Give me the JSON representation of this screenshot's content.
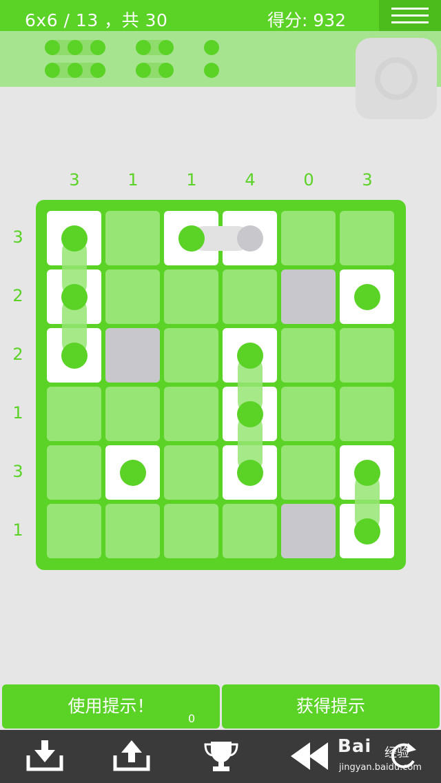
{
  "header": {
    "level_text": "6x6 / 13 ，共 30",
    "score_text": "得分: 932",
    "menu_icon": "hamburger-menu-icon",
    "accent_color": "#5ad226"
  },
  "pieces_tray": {
    "groups": [
      {
        "name": "size-3",
        "rows": 2,
        "dots_per_row": 3
      },
      {
        "name": "size-2",
        "rows": 2,
        "dots_per_row": 2
      },
      {
        "name": "size-1",
        "rows": 2,
        "dots_per_row": 1
      }
    ]
  },
  "board": {
    "size": 6,
    "column_clues": [
      "3",
      "1",
      "1",
      "4",
      "0",
      "3"
    ],
    "row_clues": [
      "3",
      "2",
      "2",
      "1",
      "3",
      "1"
    ],
    "cells": [
      [
        "ship",
        "water",
        "ship",
        "ship-grey",
        "water",
        "water"
      ],
      [
        "ship",
        "water",
        "water",
        "water",
        "block",
        "ship"
      ],
      [
        "ship",
        "block",
        "water",
        "ship",
        "water",
        "water"
      ],
      [
        "water",
        "water",
        "water",
        "ship",
        "water",
        "water"
      ],
      [
        "water",
        "ship",
        "water",
        "ship",
        "water",
        "ship"
      ],
      [
        "water",
        "water",
        "water",
        "water",
        "block",
        "ship"
      ]
    ]
  },
  "actions": {
    "use_hint_label": "使用提示！",
    "hint_count": "0",
    "get_hint_label": "获得提示"
  },
  "toolbar": {
    "items": [
      "download-icon",
      "upload-icon",
      "trophy-icon",
      "rewind-icon",
      "restart-icon"
    ]
  },
  "watermark": {
    "logo": "Bai",
    "text": "经验",
    "url": "jingyan.baidu.com"
  }
}
